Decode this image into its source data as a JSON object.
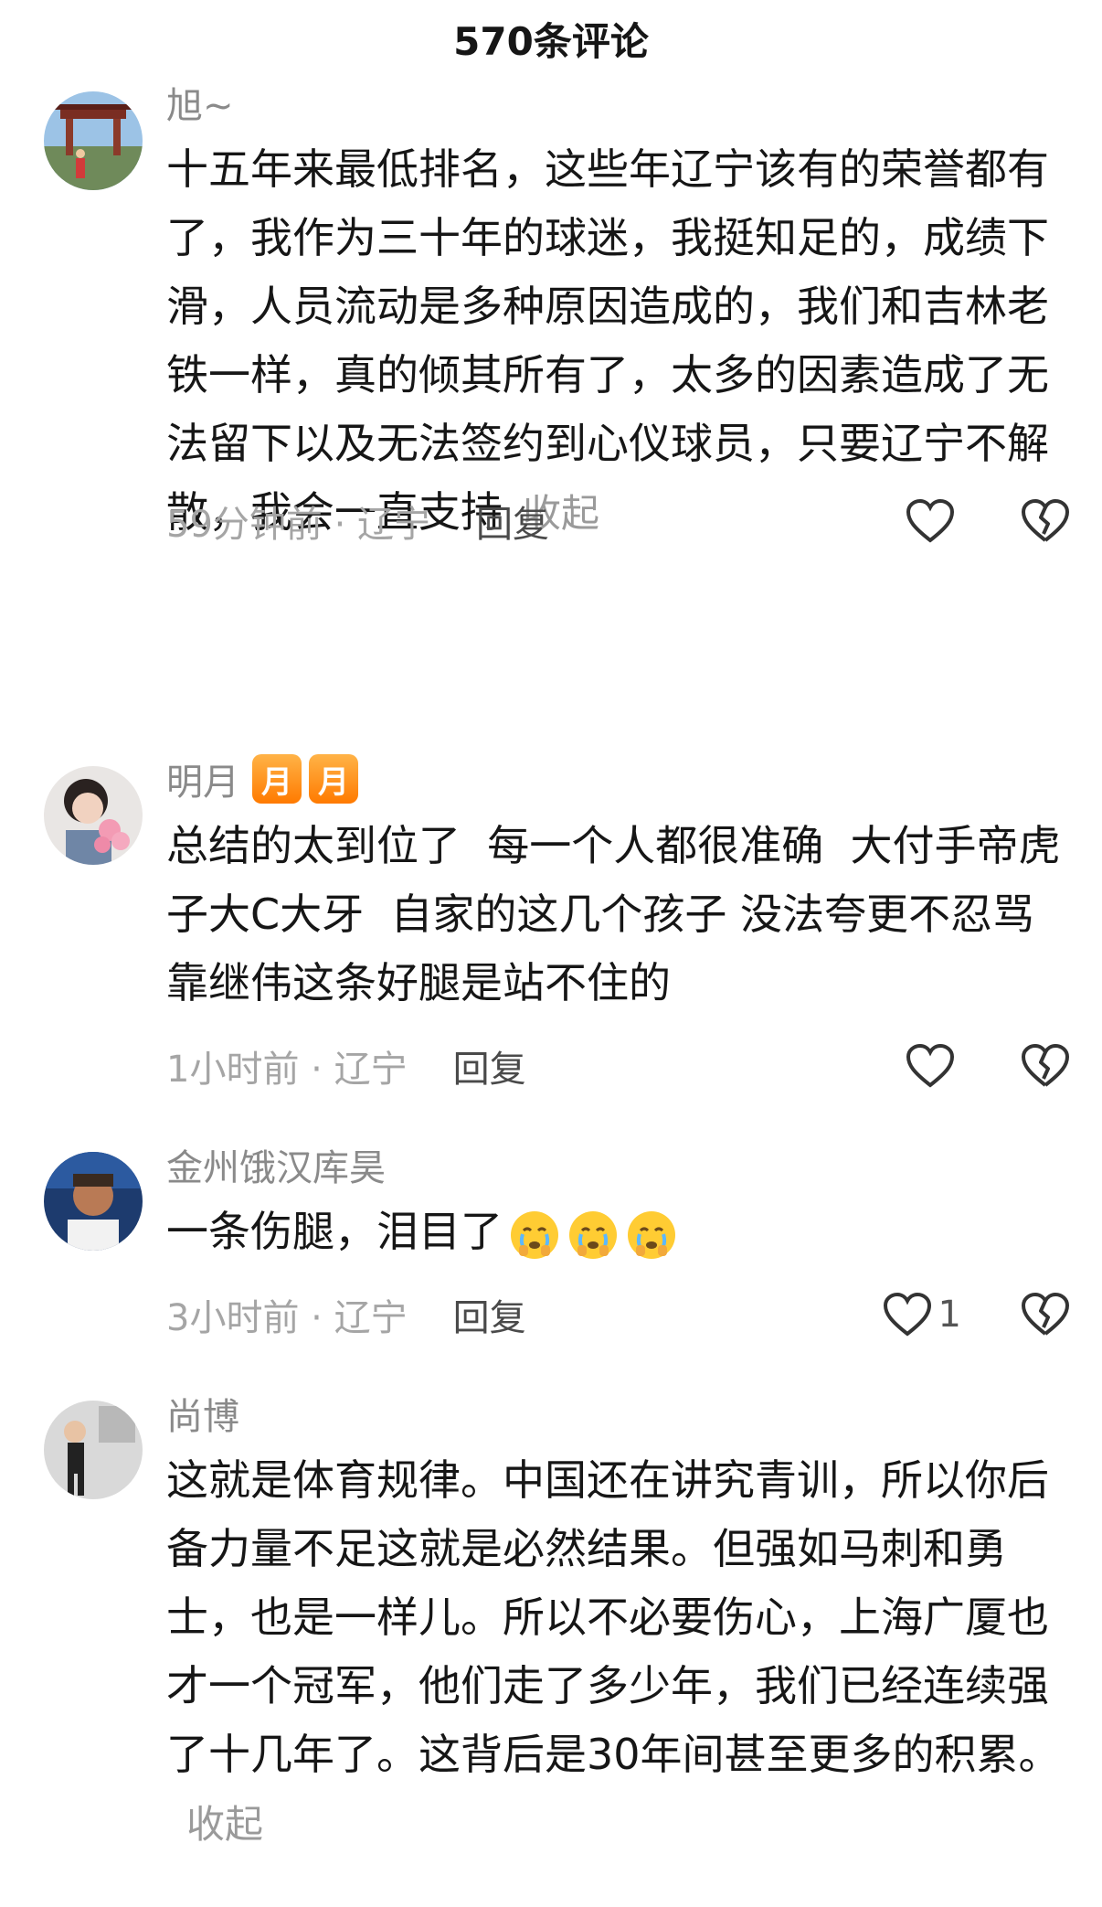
{
  "header": {
    "title": "570条评论"
  },
  "comments": [
    {
      "username": "旭~",
      "text": "十五年来最低排名，这些年辽宁该有的荣誉都有了，我作为三十年的球迷，我挺知足的，成绩下滑，人员流动是多种原因造成的，我们和吉林老铁一样，真的倾其所有了，太多的因素造成了无法留下以及无法签约到心仪球员，只要辽宁不解散，我会一直支持",
      "collapse": "收起",
      "time": "59分钟前 · 辽宁",
      "reply": "回复",
      "likes": ""
    },
    {
      "username": "明月",
      "badges": [
        "月",
        "月"
      ],
      "text": "总结的太到位了  每一个人都很准确  大付手帝虎子大C大牙  自家的这几个孩子 没法夸更不忍骂  靠继伟这条好腿是站不住的",
      "time": "1小时前 · 辽宁",
      "reply": "回复",
      "likes": ""
    },
    {
      "username": "金州饿汉库昊",
      "text": "一条伤腿，泪目了",
      "emojis": [
        "crying-face-icon",
        "crying-face-icon",
        "crying-face-icon"
      ],
      "time": "3小时前 · 辽宁",
      "reply": "回复",
      "likes": "1"
    },
    {
      "username": "尚博",
      "text": "这就是体育规律。中国还在讲究青训，所以你后备力量不足这就是必然结果。但强如马刺和勇士，也是一样儿。所以不必要伤心，上海广厦也才一个冠军，他们走了多少年，我们已经连续强了十几年了。这背后是30年间甚至更多的积累。",
      "collapse": "收起"
    }
  ],
  "colors": {
    "text": "#161616",
    "muted": "#8a8a8a",
    "badge": "#ff8a00"
  },
  "icons": {
    "like": "heart-outline-icon",
    "dislike": "broken-heart-icon"
  }
}
